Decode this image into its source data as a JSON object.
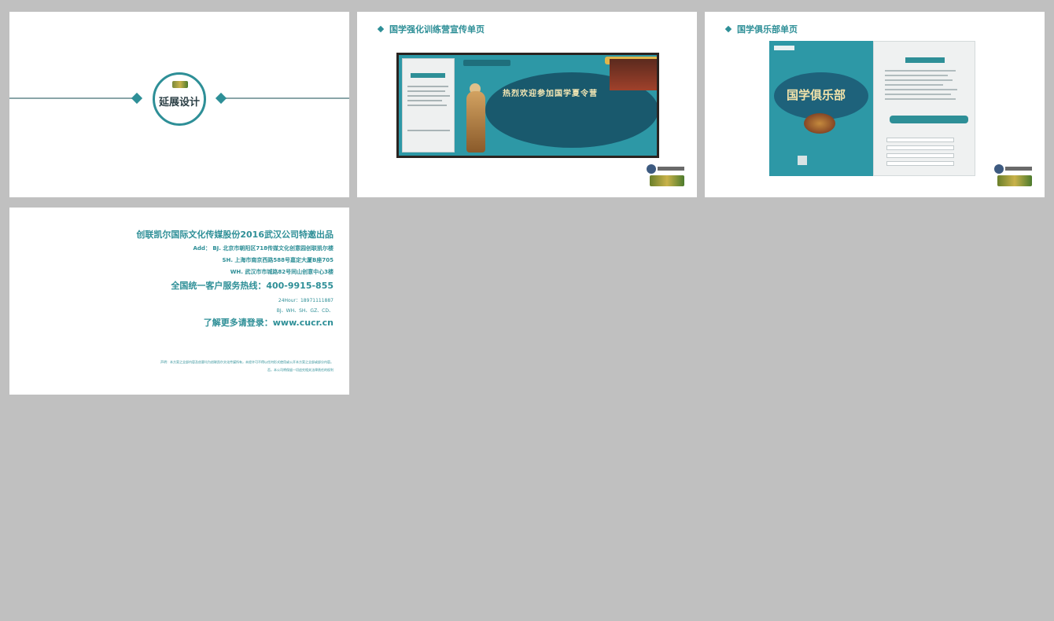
{
  "slides": [
    {
      "id": "cover",
      "title": "延展设计"
    },
    {
      "id": "banner",
      "heading": "国学强化训练营宣传单页",
      "banner_title": "热烈欢迎参加国学夏令营"
    },
    {
      "id": "brochure",
      "heading": "国学俱乐部单页",
      "brochure_title": "国学俱乐部"
    },
    {
      "id": "contact",
      "company": "创联凯尔国际文化传媒股份2016武汉公司特邀出品",
      "address_bj": "Add： BJ. 北京市朝阳区718传媒文化创意园创联凯尔楼",
      "address_sh": "SH. 上海市南京西路588号嘉定大厦B座705",
      "address_wh": "WH. 武汉市市城路82号同山创意中心3楼",
      "hotline": "全国统一客户服务热线：400-9915-855",
      "hotline_24": "24Hour：18971111887",
      "cities": "BJ、WH、SH、GZ、CD、",
      "website": "了解更多请登录：www.cucr.cn",
      "disclaimer_1": "声明：本方案之全部内容及创意均为创联凯尔文化传媒所有，未经许可不得以任何形式使用或公开本方案之全部或部分内容。",
      "disclaimer_2": "否，本公司将保留一切追究相关法律责任的权利"
    }
  ],
  "colors": {
    "accent": "#2e8f97",
    "background": "#c0c0c0",
    "slide": "#ffffff"
  }
}
